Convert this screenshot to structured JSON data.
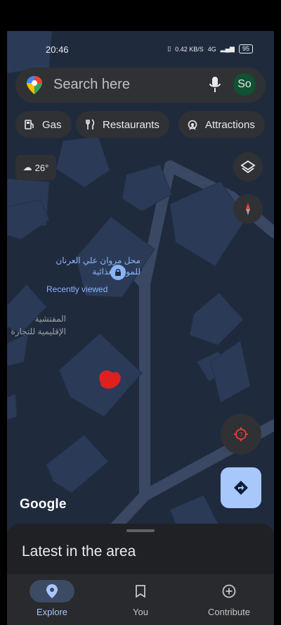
{
  "status_bar": {
    "time": "20:46",
    "network_speed": "0.42 KB/S",
    "network_type": "4G",
    "battery": "95"
  },
  "search": {
    "placeholder": "Search here",
    "avatar_initials": "So"
  },
  "chips": [
    {
      "label": "Gas",
      "icon": "gas-station-icon"
    },
    {
      "label": "Restaurants",
      "icon": "fork-knife-icon"
    },
    {
      "label": "Attractions",
      "icon": "attractions-icon"
    }
  ],
  "weather": {
    "temperature": "26°",
    "icon": "partly-cloudy-icon"
  },
  "map": {
    "poi": {
      "name_line1": "محل مروان علي العرنان",
      "name_line2": "للمواد الغذائية",
      "status": "Recently viewed"
    },
    "area_label": {
      "line1": "المفتشية",
      "line2": "الإقليمية للتجارة"
    },
    "attribution": "Google"
  },
  "sheet": {
    "title": "Latest in the area"
  },
  "nav": {
    "items": [
      {
        "label": "Explore",
        "icon": "location-pin-icon",
        "active": true
      },
      {
        "label": "You",
        "icon": "bookmark-icon",
        "active": false
      },
      {
        "label": "Contribute",
        "icon": "add-circle-icon",
        "active": false
      }
    ]
  },
  "colors": {
    "map_background": "#1f2a3d",
    "building": "#2b3b57",
    "road": "#33415a",
    "accent": "#a8c7fa",
    "location_dot": "#e02020"
  }
}
